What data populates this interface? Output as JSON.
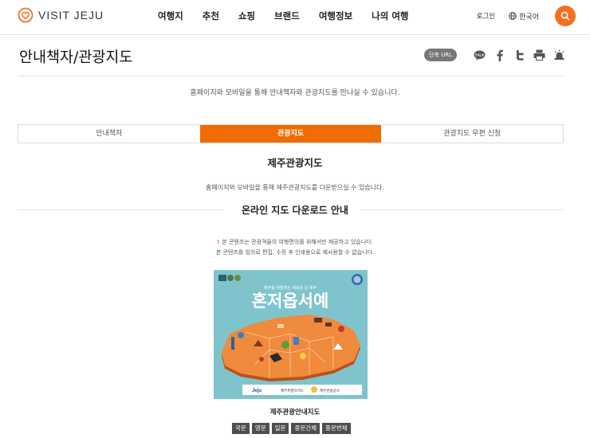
{
  "header": {
    "logo_text": "VISIT JEJU",
    "nav": [
      "여행지",
      "추천",
      "쇼핑",
      "브랜드",
      "여행정보",
      "나의 여행"
    ],
    "login": "로그인",
    "language": "한국어",
    "brand_color": "#f37021"
  },
  "page": {
    "title": "안내책자/관광지도",
    "short_url": "단축 URL",
    "share_icons": [
      "talk-icon",
      "facebook-icon",
      "twitter-icon",
      "print-icon",
      "alarm-icon"
    ],
    "intro": "홈페이지와 모바일을 통해 안내책자와 관광지도를 만나실 수 있습니다."
  },
  "tabs": [
    {
      "label": "안내책자",
      "active": false
    },
    {
      "label": "관광지도",
      "active": true
    },
    {
      "label": "관광지도 우편 신청",
      "active": false
    }
  ],
  "section": {
    "title": "제주관광지도",
    "desc": "홈페이지와 모바일을 통해 제주관광지도를 다운받으실 수 있습니다.",
    "subtitle": "온라인 지도 다운로드 안내",
    "notice_mark": "!",
    "notice_line1": "본 콘텐츠는 관광객들의 여행편의를 위해서만 제공하고 있습니다.",
    "notice_line2": "본 콘텐츠를 임의로 편집, 수정 후 인쇄용으로 재사용할 수 없습니다."
  },
  "map": {
    "cover_subtitle": "제주를 여행하는 새로운 길 제주",
    "cover_title": "혼저옵서예",
    "footer_left": "Jeju",
    "footer_mid": "제주특별자치도",
    "footer_right": "제주관광공사",
    "caption": "제주관광안내지도",
    "languages": [
      "국문",
      "영문",
      "일문",
      "중문간체",
      "중문번체"
    ]
  }
}
